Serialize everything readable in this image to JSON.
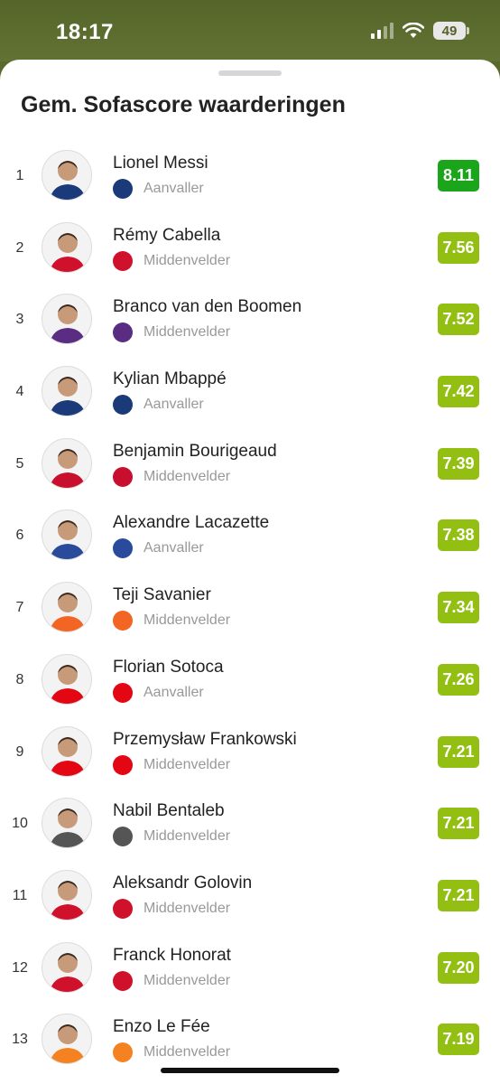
{
  "status": {
    "time": "18:17",
    "battery": "49"
  },
  "title": "Gem. Sofascore waarderingen",
  "colors": {
    "top_rating": "#1aa51a",
    "rating": "#93bf12"
  },
  "players": [
    {
      "rank": "1",
      "name": "Lionel Messi",
      "position": "Aanvaller",
      "rating": "8.11",
      "club_icon": "psg-crest-icon",
      "club_color": "#1b3a7a",
      "top": true
    },
    {
      "rank": "2",
      "name": "Rémy Cabella",
      "position": "Middenvelder",
      "rating": "7.56",
      "club_icon": "lille-crest-icon",
      "club_color": "#d0112b"
    },
    {
      "rank": "3",
      "name": "Branco van den Boomen",
      "position": "Middenvelder",
      "rating": "7.52",
      "club_icon": "toulouse-crest-icon",
      "club_color": "#5a2d82"
    },
    {
      "rank": "4",
      "name": "Kylian Mbappé",
      "position": "Aanvaller",
      "rating": "7.42",
      "club_icon": "psg-crest-icon",
      "club_color": "#1b3a7a"
    },
    {
      "rank": "5",
      "name": "Benjamin Bourigeaud",
      "position": "Middenvelder",
      "rating": "7.39",
      "club_icon": "rennes-crest-icon",
      "club_color": "#c8102e"
    },
    {
      "rank": "6",
      "name": "Alexandre Lacazette",
      "position": "Aanvaller",
      "rating": "7.38",
      "club_icon": "lyon-crest-icon",
      "club_color": "#2a4b9b"
    },
    {
      "rank": "7",
      "name": "Teji Savanier",
      "position": "Middenvelder",
      "rating": "7.34",
      "club_icon": "montpellier-crest-icon",
      "club_color": "#f26522"
    },
    {
      "rank": "8",
      "name": "Florian Sotoca",
      "position": "Aanvaller",
      "rating": "7.26",
      "club_icon": "lens-crest-icon",
      "club_color": "#e30613"
    },
    {
      "rank": "9",
      "name": "Przemysław Frankowski",
      "position": "Middenvelder",
      "rating": "7.21",
      "club_icon": "lens-crest-icon",
      "club_color": "#e30613"
    },
    {
      "rank": "10",
      "name": "Nabil Bentaleb",
      "position": "Middenvelder",
      "rating": "7.21",
      "club_icon": "angers-crest-icon",
      "club_color": "#555555"
    },
    {
      "rank": "11",
      "name": "Aleksandr Golovin",
      "position": "Middenvelder",
      "rating": "7.21",
      "club_icon": "monaco-crest-icon",
      "club_color": "#d0112b"
    },
    {
      "rank": "12",
      "name": "Franck Honorat",
      "position": "Middenvelder",
      "rating": "7.20",
      "club_icon": "brest-crest-icon",
      "club_color": "#d0112b"
    },
    {
      "rank": "13",
      "name": "Enzo Le Fée",
      "position": "Middenvelder",
      "rating": "7.19",
      "club_icon": "lorient-crest-icon",
      "club_color": "#f58220"
    }
  ]
}
